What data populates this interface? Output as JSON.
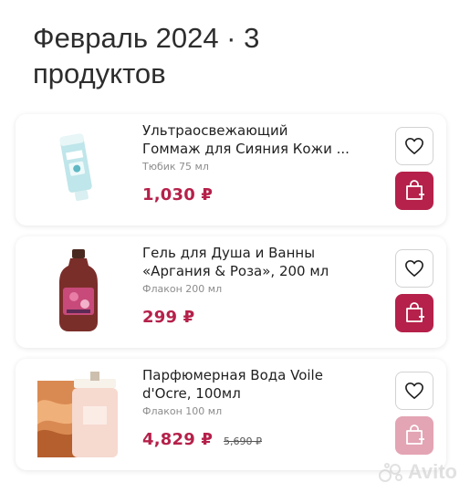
{
  "header": {
    "title": "Февраль 2024 · 3\nпродуктов"
  },
  "colors": {
    "accent": "#b5214a",
    "accent_disabled": "#e3a4b4"
  },
  "products": [
    {
      "name": "Ультраосвежающий\nГоммаж для Сияния Кожи ...",
      "variant": "Тюбик 75 мл",
      "price": "1,030 ₽",
      "old_price": "",
      "favorite_icon": "heart-outline-icon",
      "cart_icon": "shopping-bag-plus-icon",
      "cart_state": "active"
    },
    {
      "name": "Гель для Душа и Ванны\n«Аргания & Роза», 200 мл",
      "variant": "Флакон 200 мл",
      "price": "299 ₽",
      "old_price": "",
      "favorite_icon": "heart-outline-icon",
      "cart_icon": "shopping-bag-plus-icon",
      "cart_state": "active"
    },
    {
      "name": "Парфюмерная Вода Voile\nd'Ocre, 100мл",
      "variant": "Флакон 100 мл",
      "price": "4,829 ₽",
      "old_price": "5,690 ₽",
      "favorite_icon": "heart-outline-icon",
      "cart_icon": "shopping-bag-plus-icon",
      "cart_state": "disabled"
    }
  ],
  "watermark": {
    "text": "Avito"
  }
}
